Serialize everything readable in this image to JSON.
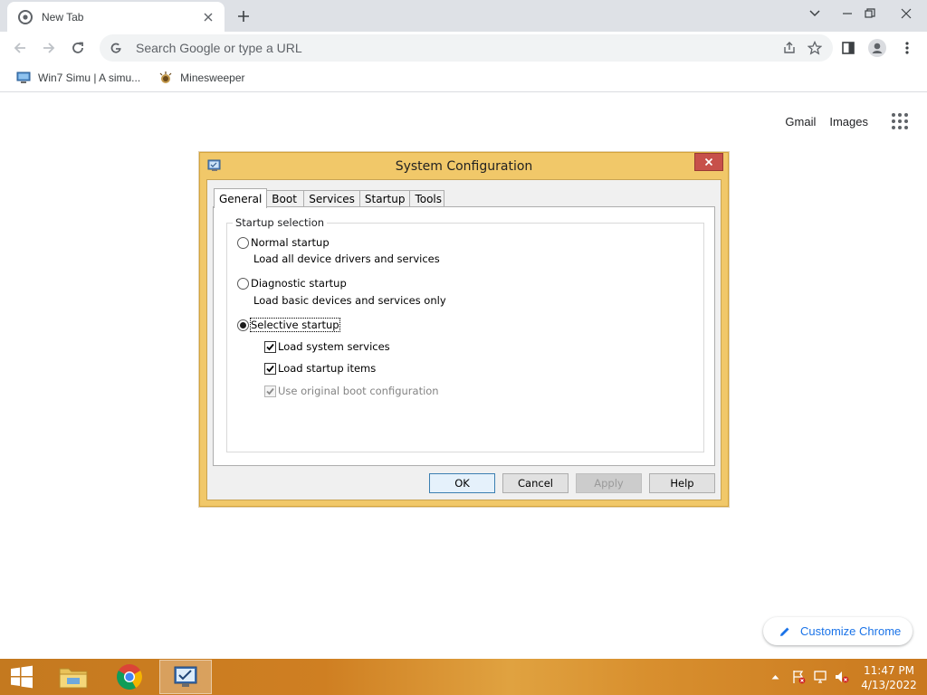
{
  "browser": {
    "tab_title": "New Tab",
    "omnibox_placeholder": "Search Google or type a URL",
    "bookmarks": [
      {
        "label": "Win7 Simu | A simu...",
        "icon": "computer-icon"
      },
      {
        "label": "Minesweeper",
        "icon": "mine-icon"
      }
    ]
  },
  "ntp": {
    "gmail_label": "Gmail",
    "images_label": "Images",
    "customize_label": "Customize Chrome"
  },
  "dialog": {
    "title": "System Configuration",
    "tabs": [
      "General",
      "Boot",
      "Services",
      "Startup",
      "Tools"
    ],
    "active_tab": "General",
    "group_label": "Startup selection",
    "normal_label": "Normal startup",
    "normal_desc": "Load all device drivers and services",
    "diagnostic_label": "Diagnostic startup",
    "diagnostic_desc": "Load basic devices and services only",
    "selective_label": "Selective startup",
    "selected_option": "selective",
    "check_services_label": "Load system services",
    "check_services_checked": true,
    "check_startup_label": "Load startup items",
    "check_startup_checked": true,
    "check_boot_label": "Use original boot configuration",
    "check_boot_checked": true,
    "check_boot_disabled": true,
    "buttons": {
      "ok": "OK",
      "cancel": "Cancel",
      "apply": "Apply",
      "help": "Help"
    }
  },
  "taskbar": {
    "time": "11:47 PM",
    "date": "4/13/2022",
    "apps": [
      "file-explorer-icon",
      "chrome-icon",
      "system-configuration-icon"
    ]
  },
  "colors": {
    "dialog_frame": "#f1c869",
    "close_button": "#c7504a",
    "taskbar": "#cf7f22",
    "link_blue": "#1a73e8"
  }
}
